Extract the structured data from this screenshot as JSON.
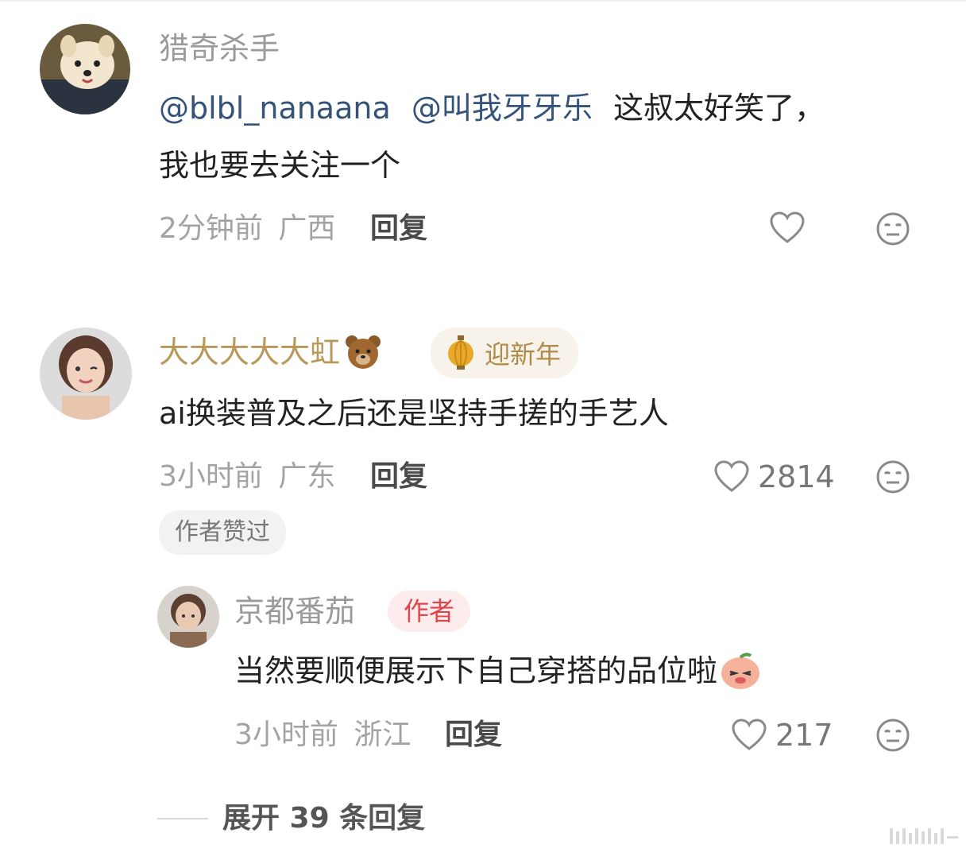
{
  "comments": [
    {
      "username": "猎奇杀手",
      "mentions": [
        "@blbl_nanaana",
        "@叫我牙牙乐"
      ],
      "text_line1": "这叔太好笑了，",
      "text_line2": "我也要去关注一个",
      "time": "2分钟前",
      "location": "广西",
      "reply_label": "回复",
      "like_count": "",
      "avatar_icon": "dog-avatar-icon"
    },
    {
      "username": "大大大大大虹",
      "username_emoji": "bear-emoji-icon",
      "badge": "迎新年",
      "badge_icon": "lantern-icon",
      "text": "ai换装普及之后还是坚持手搓的手艺人",
      "time": "3小时前",
      "location": "广东",
      "reply_label": "回复",
      "like_count": "2814",
      "chip": "作者赞过",
      "avatar_icon": "woman-avatar-icon"
    }
  ],
  "reply": {
    "username": "京都番茄",
    "author_badge": "作者",
    "text": "当然要顺便展示下自己穿搭的品位啦",
    "text_emoji": "peach-face-emoji-icon",
    "time": "3小时前",
    "location": "浙江",
    "reply_label": "回复",
    "like_count": "217",
    "avatar_icon": "man-avatar-icon"
  },
  "expand_replies": "展开 39 条回复",
  "colors": {
    "username": "#9a9a9a",
    "username_vip": "#b9985a",
    "mention": "#34527a",
    "author_badge": "#e0454b"
  }
}
